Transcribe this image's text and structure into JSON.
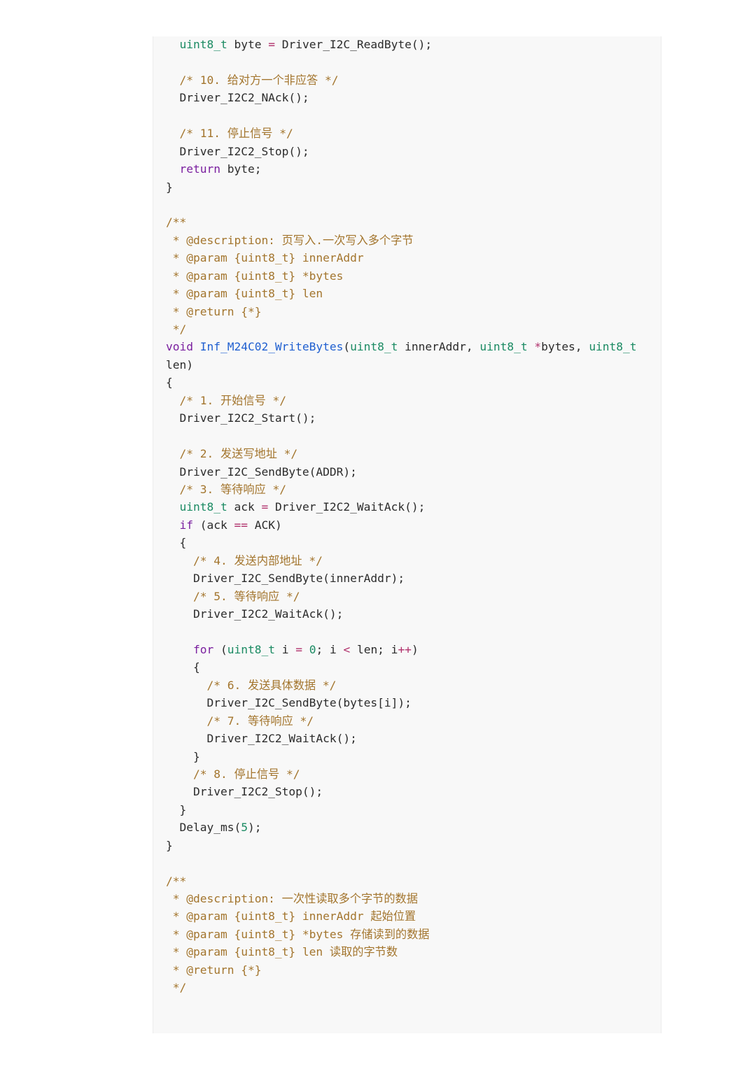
{
  "code_lines": [
    [
      {
        "t": "  "
      },
      {
        "t": "uint8_t",
        "c": "ty"
      },
      {
        "t": " byte "
      },
      {
        "t": "=",
        "c": "op"
      },
      {
        "t": " Driver_I2C_ReadByte();"
      }
    ],
    [],
    [
      {
        "t": "  "
      },
      {
        "t": "/* 10. 给对方一个非应答 */",
        "c": "cm"
      }
    ],
    [
      {
        "t": "  Driver_I2C2_NAck();"
      }
    ],
    [],
    [
      {
        "t": "  "
      },
      {
        "t": "/* 11. 停止信号 */",
        "c": "cm"
      }
    ],
    [
      {
        "t": "  Driver_I2C2_Stop();"
      }
    ],
    [
      {
        "t": "  "
      },
      {
        "t": "return",
        "c": "kw"
      },
      {
        "t": " byte;"
      }
    ],
    [
      {
        "t": "}"
      }
    ],
    [],
    [
      {
        "t": "/**",
        "c": "cm"
      }
    ],
    [
      {
        "t": " * @description: 页写入.一次写入多个字节",
        "c": "cm"
      }
    ],
    [
      {
        "t": " * @param {uint8_t} innerAddr",
        "c": "cm"
      }
    ],
    [
      {
        "t": " * @param {uint8_t} *bytes",
        "c": "cm"
      }
    ],
    [
      {
        "t": " * @param {uint8_t} len",
        "c": "cm"
      }
    ],
    [
      {
        "t": " * @return {*}",
        "c": "cm"
      }
    ],
    [
      {
        "t": " */",
        "c": "cm"
      }
    ],
    [
      {
        "t": "void",
        "c": "kw"
      },
      {
        "t": " "
      },
      {
        "t": "Inf_M24C02_WriteBytes",
        "c": "fn"
      },
      {
        "t": "("
      },
      {
        "t": "uint8_t",
        "c": "ty"
      },
      {
        "t": " innerAddr, "
      },
      {
        "t": "uint8_t",
        "c": "ty"
      },
      {
        "t": " "
      },
      {
        "t": "*",
        "c": "op"
      },
      {
        "t": "bytes, "
      },
      {
        "t": "uint8_t",
        "c": "ty"
      }
    ],
    [
      {
        "t": "len)"
      }
    ],
    [
      {
        "t": "{"
      }
    ],
    [
      {
        "t": "  "
      },
      {
        "t": "/* 1. 开始信号 */",
        "c": "cm"
      }
    ],
    [
      {
        "t": "  Driver_I2C2_Start();"
      }
    ],
    [],
    [
      {
        "t": "  "
      },
      {
        "t": "/* 2. 发送写地址 */",
        "c": "cm"
      }
    ],
    [
      {
        "t": "  Driver_I2C_SendByte(ADDR);"
      }
    ],
    [
      {
        "t": "  "
      },
      {
        "t": "/* 3. 等待响应 */",
        "c": "cm"
      }
    ],
    [
      {
        "t": "  "
      },
      {
        "t": "uint8_t",
        "c": "ty"
      },
      {
        "t": " ack "
      },
      {
        "t": "=",
        "c": "op"
      },
      {
        "t": " Driver_I2C2_WaitAck();"
      }
    ],
    [
      {
        "t": "  "
      },
      {
        "t": "if",
        "c": "kw"
      },
      {
        "t": " (ack "
      },
      {
        "t": "==",
        "c": "op"
      },
      {
        "t": " ACK)"
      }
    ],
    [
      {
        "t": "  {"
      }
    ],
    [
      {
        "t": "    "
      },
      {
        "t": "/* 4. 发送内部地址 */",
        "c": "cm"
      }
    ],
    [
      {
        "t": "    Driver_I2C_SendByte(innerAddr);"
      }
    ],
    [
      {
        "t": "    "
      },
      {
        "t": "/* 5. 等待响应 */",
        "c": "cm"
      }
    ],
    [
      {
        "t": "    Driver_I2C2_WaitAck();"
      }
    ],
    [],
    [
      {
        "t": "    "
      },
      {
        "t": "for",
        "c": "kw"
      },
      {
        "t": " ("
      },
      {
        "t": "uint8_t",
        "c": "ty"
      },
      {
        "t": " i "
      },
      {
        "t": "=",
        "c": "op"
      },
      {
        "t": " "
      },
      {
        "t": "0",
        "c": "num"
      },
      {
        "t": "; i "
      },
      {
        "t": "<",
        "c": "op"
      },
      {
        "t": " len; i"
      },
      {
        "t": "++",
        "c": "op"
      },
      {
        "t": ")"
      }
    ],
    [
      {
        "t": "    {"
      }
    ],
    [
      {
        "t": "      "
      },
      {
        "t": "/* 6. 发送具体数据 */",
        "c": "cm"
      }
    ],
    [
      {
        "t": "      Driver_I2C_SendByte(bytes[i]);"
      }
    ],
    [
      {
        "t": "      "
      },
      {
        "t": "/* 7. 等待响应 */",
        "c": "cm"
      }
    ],
    [
      {
        "t": "      Driver_I2C2_WaitAck();"
      }
    ],
    [
      {
        "t": "    }"
      }
    ],
    [
      {
        "t": "    "
      },
      {
        "t": "/* 8. 停止信号 */",
        "c": "cm"
      }
    ],
    [
      {
        "t": "    Driver_I2C2_Stop();"
      }
    ],
    [
      {
        "t": "  }"
      }
    ],
    [
      {
        "t": "  Delay_ms("
      },
      {
        "t": "5",
        "c": "num"
      },
      {
        "t": ");"
      }
    ],
    [
      {
        "t": "}"
      }
    ],
    [],
    [
      {
        "t": "/**",
        "c": "cm"
      }
    ],
    [
      {
        "t": " * @description: 一次性读取多个字节的数据",
        "c": "cm"
      }
    ],
    [
      {
        "t": " * @param {uint8_t} innerAddr 起始位置",
        "c": "cm"
      }
    ],
    [
      {
        "t": " * @param {uint8_t} *bytes 存储读到的数据",
        "c": "cm"
      }
    ],
    [
      {
        "t": " * @param {uint8_t} len 读取的字节数",
        "c": "cm"
      }
    ],
    [
      {
        "t": " * @return {*}",
        "c": "cm"
      }
    ],
    [
      {
        "t": " */",
        "c": "cm"
      }
    ]
  ]
}
